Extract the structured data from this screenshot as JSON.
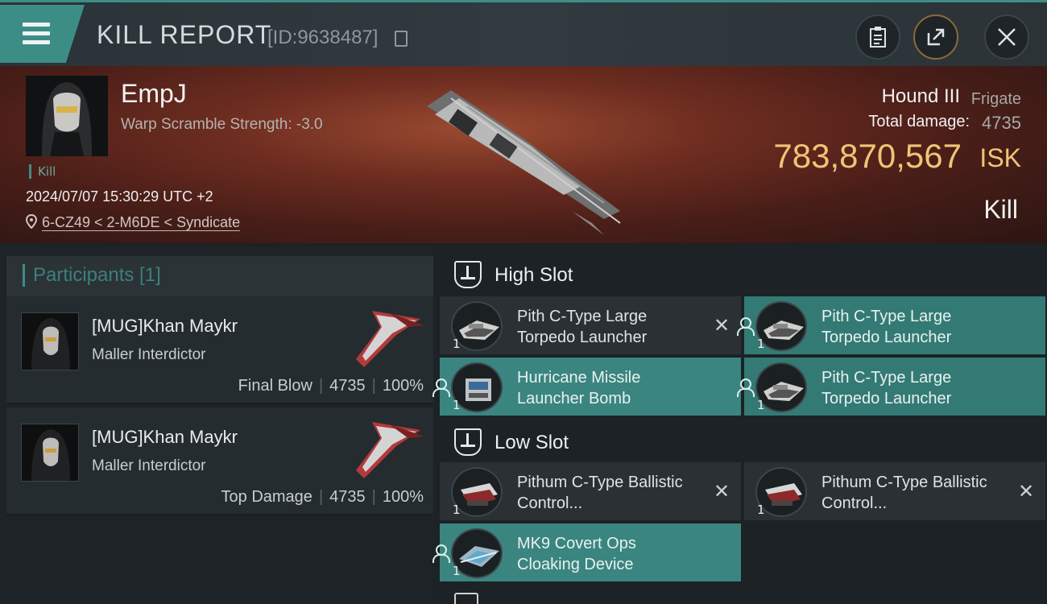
{
  "header": {
    "title": "KILL REPORT",
    "report_id": "[ID:9638487]"
  },
  "victim": {
    "name": "EmpJ",
    "warp_scramble": "Warp Scramble Strength: -3.0",
    "kill_tag": "Kill",
    "timestamp": "2024/07/07 15:30:29 UTC +2",
    "location": "6-CZ49 < 2-M6DE < Syndicate",
    "ship_name": "Hound III",
    "ship_class": "Frigate",
    "total_damage_label": "Total damage:",
    "total_damage_value": "4735",
    "isk_value": "783,870,567",
    "isk_unit": "ISK",
    "result": "Kill"
  },
  "participants": {
    "heading": "Participants [1]",
    "items": [
      {
        "name": "[MUG]Khan Maykr",
        "ship": "Maller Interdictor",
        "role": "Final Blow",
        "damage": "4735",
        "percent": "100%"
      },
      {
        "name": "[MUG]Khan Maykr",
        "ship": "Maller Interdictor",
        "role": "Top Damage",
        "damage": "4735",
        "percent": "100%"
      }
    ]
  },
  "slots": {
    "high": {
      "label": "High Slot",
      "modules": [
        {
          "name": "Pith C-Type Large Torpedo Launcher",
          "qty": "1",
          "state": "destroyed"
        },
        {
          "name": "Pith C-Type Large Torpedo Launcher",
          "qty": "1",
          "state": "dropped"
        },
        {
          "name": "Hurricane Missile Launcher Bomb",
          "qty": "1",
          "state": "dropped"
        },
        {
          "name": "Pith C-Type Large Torpedo Launcher",
          "qty": "1",
          "state": "dropped"
        }
      ]
    },
    "low": {
      "label": "Low Slot",
      "modules": [
        {
          "name": "Pithum C-Type Ballistic Control...",
          "qty": "1",
          "state": "destroyed"
        },
        {
          "name": "Pithum C-Type Ballistic Control...",
          "qty": "1",
          "state": "destroyed"
        },
        {
          "name": "MK9 Covert Ops Cloaking Device",
          "qty": "1",
          "state": "dropped"
        }
      ]
    }
  },
  "icons": {
    "menu": "hamburger-menu-icon",
    "copy": "copy-icon",
    "clipboard": "clipboard-icon",
    "share": "share-icon",
    "close": "close-icon",
    "location": "location-pin-icon",
    "destroyed": "x-icon",
    "dropped": "person-icon"
  },
  "colors": {
    "accent": "#3e8d86",
    "isk": "#f0c477",
    "banner": "#6e2d20"
  }
}
